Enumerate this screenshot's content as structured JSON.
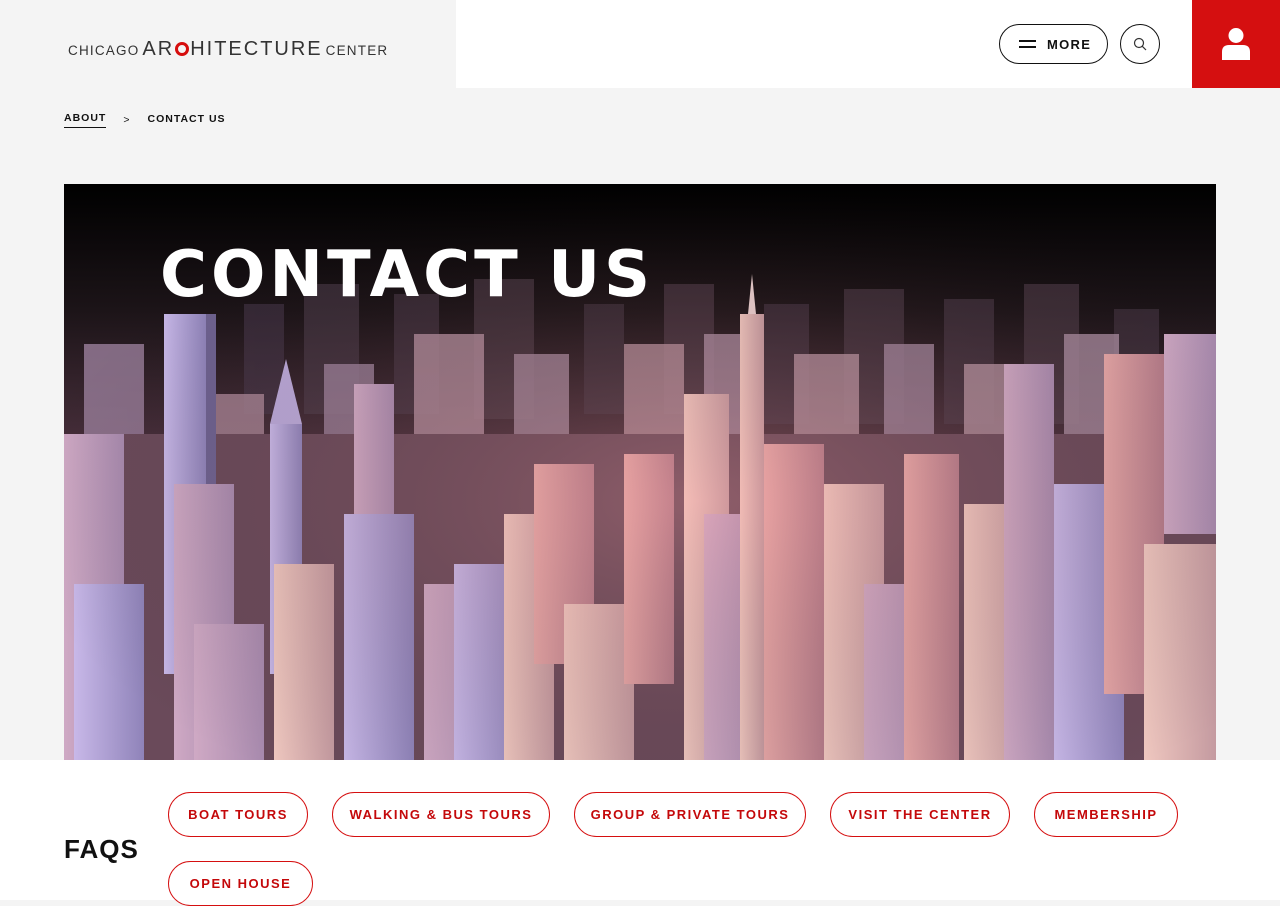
{
  "header": {
    "logo": {
      "part1": "CHICAGO",
      "part2a": "AR",
      "part2b": "HITECTURE",
      "part3": "CENTER"
    },
    "more_label": "MORE",
    "search_icon": "search-icon",
    "account_icon": "user-icon",
    "accent_color": "#d50f10"
  },
  "breadcrumb": {
    "parent": "ABOUT",
    "separator": ">",
    "current": "CONTACT US"
  },
  "hero": {
    "title": "CONTACT US"
  },
  "faqs": {
    "title": "FAQS",
    "items": [
      {
        "label": "BOAT TOURS"
      },
      {
        "label": "WALKING & BUS TOURS"
      },
      {
        "label": "GROUP & PRIVATE TOURS"
      },
      {
        "label": "VISIT THE CENTER"
      },
      {
        "label": "MEMBERSHIP"
      },
      {
        "label": "OPEN HOUSE"
      }
    ]
  }
}
